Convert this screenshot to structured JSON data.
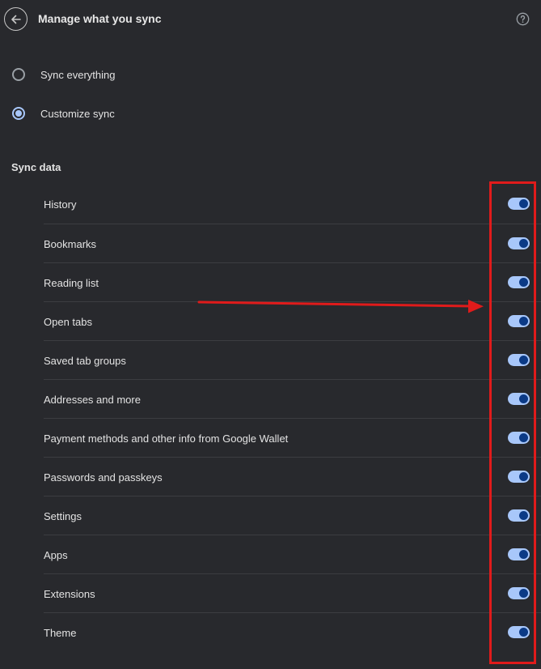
{
  "header": {
    "title": "Manage what you sync",
    "back_icon": "arrow-left-icon",
    "help_icon": "help-circle-icon"
  },
  "sync_mode": {
    "options": [
      {
        "label": "Sync everything",
        "selected": false
      },
      {
        "label": "Customize sync",
        "selected": true
      }
    ]
  },
  "sync_data": {
    "title": "Sync data",
    "items": [
      {
        "label": "History",
        "enabled": true
      },
      {
        "label": "Bookmarks",
        "enabled": true
      },
      {
        "label": "Reading list",
        "enabled": true
      },
      {
        "label": "Open tabs",
        "enabled": true
      },
      {
        "label": "Saved tab groups",
        "enabled": true
      },
      {
        "label": "Addresses and more",
        "enabled": true
      },
      {
        "label": "Payment methods and other info from Google Wallet",
        "enabled": true
      },
      {
        "label": "Passwords and passkeys",
        "enabled": true
      },
      {
        "label": "Settings",
        "enabled": true
      },
      {
        "label": "Apps",
        "enabled": true
      },
      {
        "label": "Extensions",
        "enabled": true
      },
      {
        "label": "Theme",
        "enabled": true
      }
    ]
  },
  "colors": {
    "background": "#28292d",
    "toggle_track": "#a8c7fa",
    "toggle_knob": "#0b3a86",
    "annotation": "#e01b1b"
  }
}
